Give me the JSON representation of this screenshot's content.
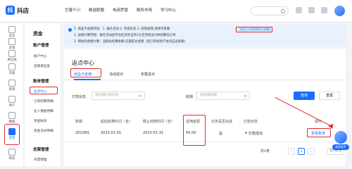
{
  "app": {
    "logo_text": "抖店"
  },
  "topnav": [
    "巨量千川",
    "精选联盟",
    "电商罗盘",
    "服务市场",
    "学习中心"
  ],
  "iconbar": [
    {
      "label": "首页",
      "icon": "home-icon"
    },
    {
      "label": "店铺",
      "icon": "store-icon"
    },
    {
      "label": "供应链",
      "icon": "supply-icon"
    },
    {
      "label": "内容",
      "icon": "content-icon"
    },
    {
      "label": "营销",
      "icon": "marketing-icon"
    },
    {
      "label": "用户",
      "icon": "user-icon"
    },
    {
      "label": "数据",
      "icon": "data-icon"
    },
    {
      "label": "资金",
      "icon": "fund-icon",
      "active": true
    },
    {
      "label": "物流",
      "icon": "logistics-icon"
    }
  ],
  "menu": {
    "title": "资金",
    "groups": [
      {
        "title": "账户管理",
        "items": [
          "账户中心",
          "店铺保证金"
        ]
      },
      {
        "title": "账单管理",
        "items": [
          "返点中心",
          "订单结算明细",
          "达人佣金明细",
          "资金账单",
          "资金流水明细"
        ]
      },
      {
        "title": "发票管理",
        "items": [
          "开票管理"
        ]
      }
    ],
    "active_item": "返点中心"
  },
  "notice": {
    "lines": [
      "1. 商品卡返佣活动：1. 报名活动 2. 完成任务 3. 获得返佣 具体可查看",
      "2. 返佣计算范围：报名活动后平台任务的当月1号至月底支付并结算的订单",
      "3. 预估的金额计算：当期总结算金额-任期前总金额（因订单退款产生的应返金额）"
    ],
    "link": "【商品卡免佣获取全攻略】"
  },
  "panel": {
    "title": "返点中心",
    "tabs": [
      "商品卡返佣",
      "活动返点",
      "年框返点"
    ],
    "active_tab": "商品卡返佣",
    "filters": {
      "payment_label": "打款状态",
      "payment_placeholder": "请选择打款状态",
      "period_label": "账期",
      "period_placeholder": "请选择账期",
      "query_button": "查询",
      "reset_button": "重置"
    },
    "columns": [
      "账期",
      "起始结算时间（含）",
      "截止结算时间（含）",
      "返佣金额",
      "任务是否完成",
      "打款状态",
      "操作"
    ],
    "rows": [
      {
        "period": "2023M1",
        "start": "2023-01-01",
        "end": "2023-01-31",
        "amount": "¥0.09",
        "task_done": "是",
        "status": "打款成功",
        "action": "查看账单"
      }
    ],
    "pagination": {
      "total": "共1条",
      "page": "1",
      "page_size": "10 条/页"
    }
  },
  "helper": {
    "label": "商家助手"
  }
}
